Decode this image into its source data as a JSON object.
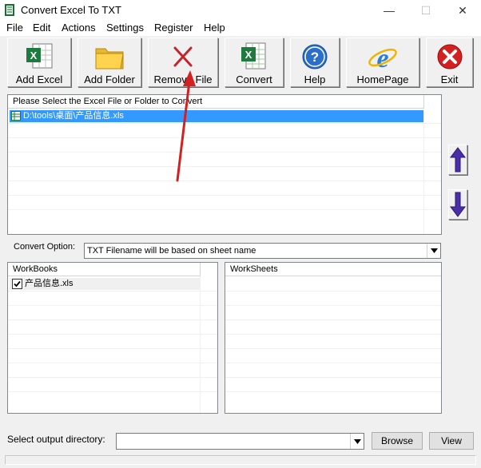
{
  "window": {
    "title": "Convert Excel To TXT",
    "minimize": "—",
    "maximize": "☐",
    "close": "✕"
  },
  "menu": [
    "File",
    "Edit",
    "Actions",
    "Settings",
    "Register",
    "Help"
  ],
  "toolbar": [
    {
      "label": "Add Excel",
      "icon": "excel-sheet-icon"
    },
    {
      "label": "Add Folder",
      "icon": "folder-icon"
    },
    {
      "label": "Remove File",
      "icon": "red-x-icon"
    },
    {
      "label": "Convert",
      "icon": "excel-convert-icon"
    },
    {
      "label": "Help",
      "icon": "help-question-icon"
    },
    {
      "label": "HomePage",
      "icon": "internet-explorer-icon"
    },
    {
      "label": "Exit",
      "icon": "exit-stop-icon"
    }
  ],
  "file_list": {
    "header": "Please Select the Excel File or Folder to Convert",
    "items": [
      "D:\\tools\\桌面\\产品信息.xls"
    ],
    "selected_index": 0
  },
  "convert_option": {
    "label": "Convert Option:",
    "value": "TXT Filename will be based on sheet name"
  },
  "workbooks": {
    "header": "WorkBooks",
    "items": [
      {
        "name": "产品信息.xls",
        "checked": true
      }
    ]
  },
  "worksheets": {
    "header": "WorkSheets",
    "items": []
  },
  "output": {
    "label": "Select  output directory:",
    "value": "",
    "browse": "Browse",
    "view": "View"
  },
  "colors": {
    "selection": "#3399ff",
    "arrow": "#4b2fa8",
    "exit_red": "#d42020"
  }
}
